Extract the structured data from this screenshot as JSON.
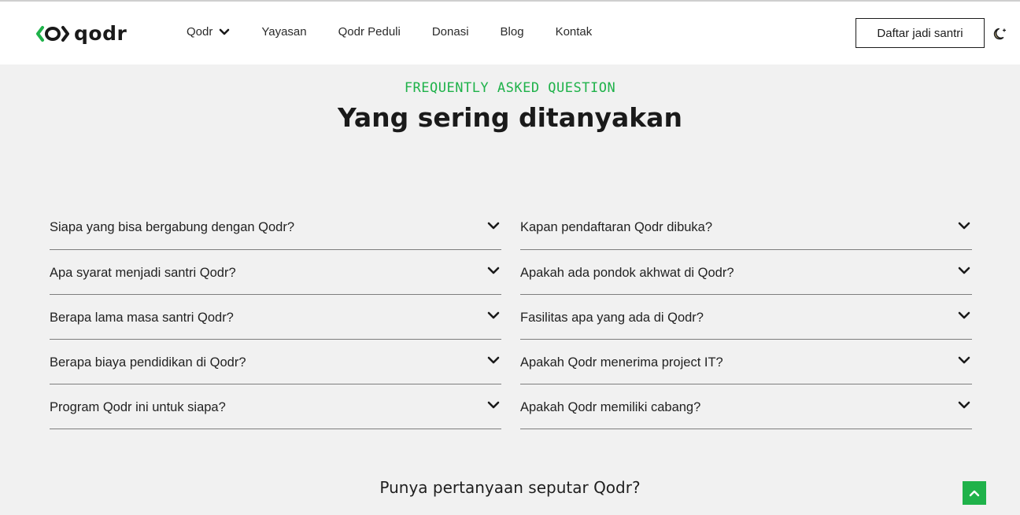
{
  "brand": {
    "name": "qodr",
    "accent": "#1fb24a"
  },
  "nav": {
    "items": [
      {
        "label": "Qodr",
        "has_dropdown": true
      },
      {
        "label": "Yayasan"
      },
      {
        "label": "Qodr Peduli"
      },
      {
        "label": "Donasi"
      },
      {
        "label": "Blog"
      },
      {
        "label": "Kontak"
      }
    ],
    "cta_label": "Daftar jadi santri",
    "theme_toggle_icon": "moon-icon"
  },
  "faq": {
    "eyebrow": "FREQUENTLY ASKED QUESTION",
    "title": "Yang sering ditanyakan",
    "left": [
      "Siapa yang bisa bergabung dengan Qodr?",
      "Apa syarat menjadi santri Qodr?",
      "Berapa lama masa santri Qodr?",
      "Berapa biaya pendidikan di Qodr?",
      "Program Qodr ini untuk siapa?"
    ],
    "right": [
      "Kapan pendaftaran Qodr dibuka?",
      "Apakah ada pondok akhwat di Qodr?",
      "Fasilitas apa yang ada di Qodr?",
      "Apakah Qodr menerima project IT?",
      "Apakah Qodr memiliki cabang?"
    ]
  },
  "contact": {
    "question": "Punya pertanyaan seputar Qodr?"
  },
  "back_to_top_icon": "chevron-up-icon"
}
